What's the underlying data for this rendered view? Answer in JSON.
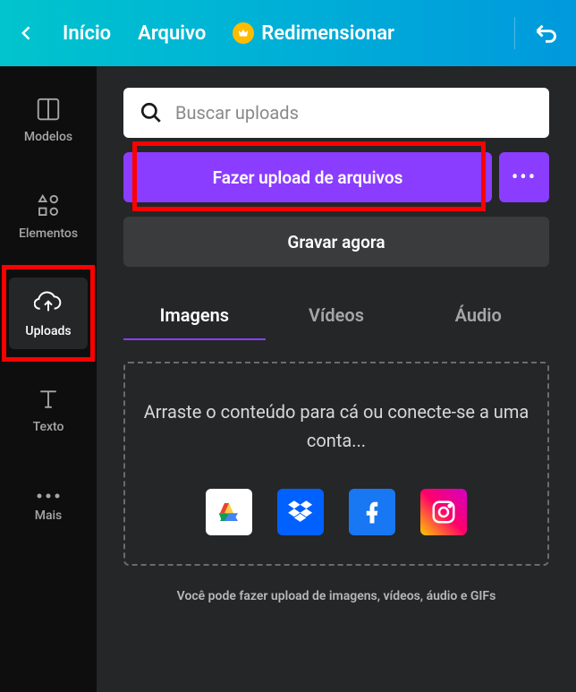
{
  "topbar": {
    "home": "Início",
    "file": "Arquivo",
    "resize": "Redimensionar"
  },
  "sidebar": {
    "templates": "Modelos",
    "elements": "Elementos",
    "uploads": "Uploads",
    "text": "Texto",
    "more": "Mais"
  },
  "content": {
    "search_placeholder": "Buscar uploads",
    "upload_button": "Fazer upload de arquivos",
    "record_button": "Gravar agora",
    "tabs": {
      "images": "Imagens",
      "videos": "Vídeos",
      "audio": "Áudio"
    },
    "dropzone_text": "Arraste o conteúdo para cá ou conecte-se a uma conta...",
    "hint": "Você pode fazer upload de imagens, vídeos, áudio e GIFs"
  }
}
